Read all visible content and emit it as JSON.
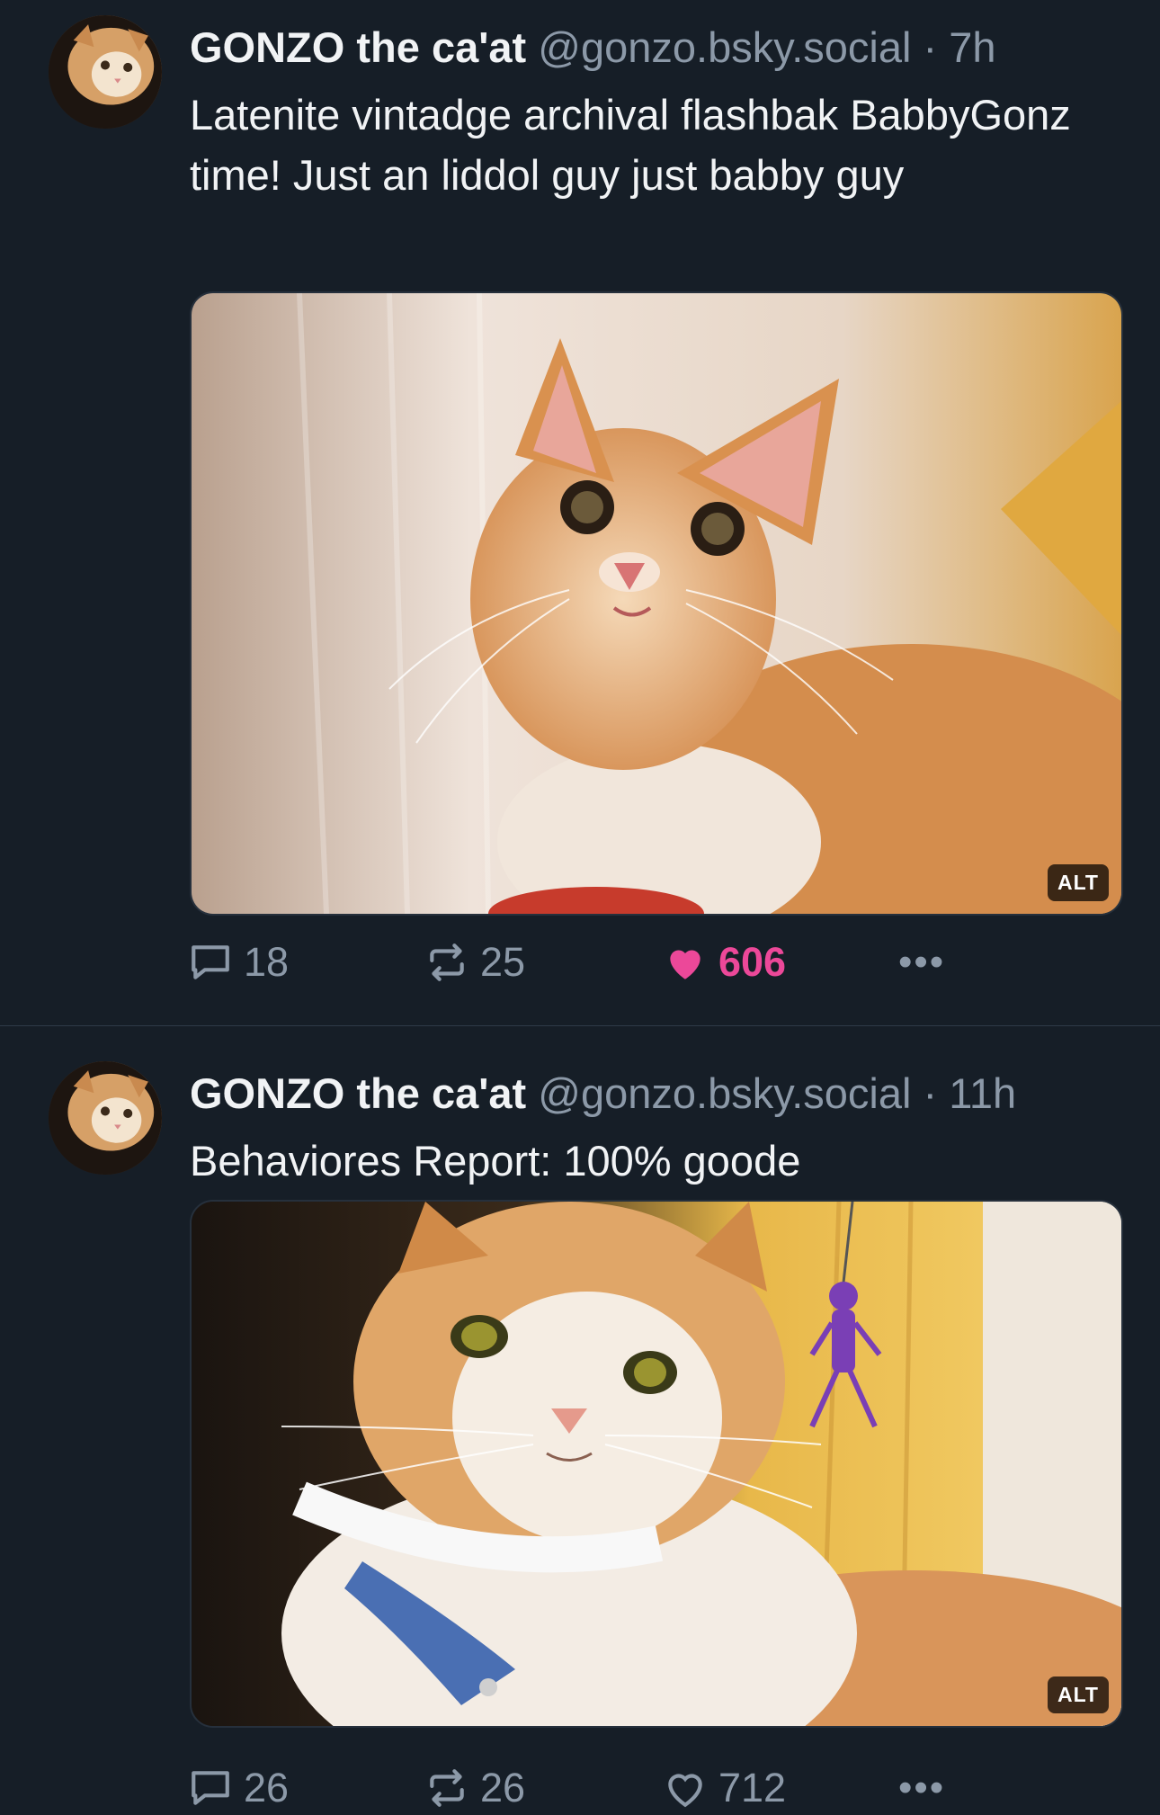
{
  "posts": [
    {
      "display_name": "GONZO the ca'at",
      "handle": "@gonzo.bsky.social",
      "separator": "·",
      "time": "7h",
      "text": "Latenite vintadge archival flashbak BabbyGonz time!  Just  an liddol guy just babby guy",
      "image_alt_badge": "ALT",
      "reply_count": "18",
      "repost_count": "25",
      "like_count": "606",
      "liked": true
    },
    {
      "display_name": "GONZO the ca'at",
      "handle": "@gonzo.bsky.social",
      "separator": "·",
      "time": "11h",
      "text": "Behaviores Report: 100% goode",
      "image_alt_badge": "ALT",
      "reply_count": "26",
      "repost_count": "26",
      "like_count": "712",
      "liked": false
    }
  ],
  "icons": {
    "reply": "reply-bubble-icon",
    "repost": "repost-arrows-icon",
    "like": "heart-icon",
    "more": "more-dots-icon"
  },
  "colors": {
    "background": "#161e27",
    "text": "#f1f3f5",
    "muted": "#8c99a8",
    "like_active": "#ec4899"
  }
}
